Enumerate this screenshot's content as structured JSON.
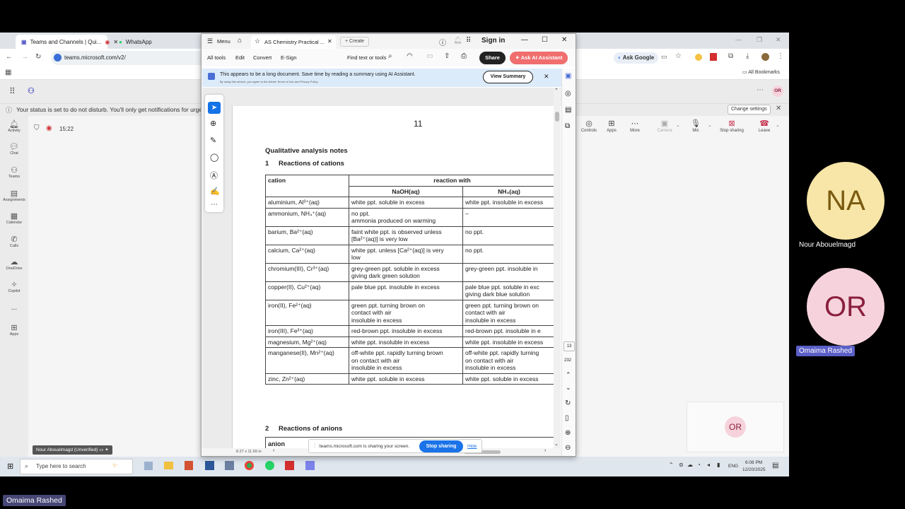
{
  "browser": {
    "tabs": [
      {
        "label": "Teams and Channels | Qui...",
        "active": true
      },
      {
        "label": "WhatsApp",
        "active": false
      }
    ],
    "url": "teams.microsoft.com/v2/",
    "ask_google": "Ask Google",
    "all_bookmarks": "All Bookmarks"
  },
  "teams": {
    "status_message": "Your status is set to do not disturb. You'll only get notifications for urgent",
    "change_settings": "Change settings",
    "call_time": "15:22",
    "avatar_initials": "OR",
    "rail": [
      {
        "label": "Activity"
      },
      {
        "label": "Chat"
      },
      {
        "label": "Teams"
      },
      {
        "label": "Assignments"
      },
      {
        "label": "Calendar"
      },
      {
        "label": "Calls"
      },
      {
        "label": "OneDrive"
      },
      {
        "label": "Copilot"
      },
      {
        "label": "..."
      },
      {
        "label": "Apps"
      }
    ],
    "call_controls": [
      {
        "label": "Controls"
      },
      {
        "label": "Apps"
      },
      {
        "label": "More"
      },
      {
        "label": "Camera"
      },
      {
        "label": "Mic"
      },
      {
        "label": "Stop sharing"
      },
      {
        "label": "Leave"
      }
    ],
    "presenter_label": "Nour Abouelmagd (Unverified)",
    "self_tile_initials": "OR"
  },
  "pdf": {
    "menu": "Menu",
    "tab_title": "AS Chemistry Practical ...",
    "create": "Create",
    "sign_in": "Sign in",
    "toolbar": [
      "All tools",
      "Edit",
      "Convert",
      "E-Sign"
    ],
    "find_text": "Find text or tools",
    "share": "Share",
    "ai_assistant": "Ask AI Assistant",
    "banner_text": "This appears to be a long document. Save time by reading a summary using AI Assistant.",
    "banner_small": "By using this service, you agree to the Adobe Terms of Use and Privacy Policy.",
    "view_summary": "View Summary",
    "page_size": "8.27 x 11.69 in",
    "current_page": "13",
    "total_pages": "232",
    "page_number_printed": "11",
    "heading": "Qualitative analysis notes",
    "section1_num": "1",
    "section1": "Reactions of cations",
    "section2_num": "2",
    "section2": "Reactions of anions",
    "anion_header": "anion",
    "table": {
      "col_cation": "cation",
      "col_reaction": "reaction with",
      "col_naoh": "NaOH(aq)",
      "col_nh3": "NH₃(aq)",
      "rows": [
        {
          "cation": "aluminium, Al³⁺(aq)",
          "naoh": [
            "white ppt. soluble in excess"
          ],
          "nh3": [
            "white ppt. insoluble in excess"
          ]
        },
        {
          "cation": "ammonium, NH₄⁺(aq)",
          "naoh": [
            "no ppt.",
            "ammonia produced on warming"
          ],
          "nh3": [
            "–"
          ]
        },
        {
          "cation": "barium, Ba²⁺(aq)",
          "naoh": [
            "faint white ppt. is observed unless",
            "[Ba²⁺(aq)] is very low"
          ],
          "nh3": [
            "no ppt."
          ]
        },
        {
          "cation": "calcium, Ca²⁺(aq)",
          "naoh": [
            "white ppt. unless [Ca²⁺(aq)] is very",
            "low"
          ],
          "nh3": [
            "no ppt."
          ]
        },
        {
          "cation": "chromium(III), Cr³⁺(aq)",
          "naoh": [
            "grey-green ppt. soluble in excess",
            "giving dark green solution"
          ],
          "nh3": [
            "grey-green ppt. insoluble in"
          ]
        },
        {
          "cation": "copper(II), Cu²⁺(aq)",
          "naoh": [
            "pale blue ppt. insoluble in excess"
          ],
          "nh3": [
            "pale blue ppt. soluble in exc",
            "giving dark blue solution"
          ]
        },
        {
          "cation": "iron(II), Fe²⁺(aq)",
          "naoh": [
            "green ppt. turning brown on",
            "contact with air",
            "insoluble in excess"
          ],
          "nh3": [
            "green ppt. turning brown on",
            "contact with air",
            "insoluble in excess"
          ]
        },
        {
          "cation": "iron(III), Fe³⁺(aq)",
          "naoh": [
            "red-brown ppt. insoluble in excess"
          ],
          "nh3": [
            "red-brown ppt. insoluble in e"
          ]
        },
        {
          "cation": "magnesium, Mg²⁺(aq)",
          "naoh": [
            "white ppt. insoluble in excess"
          ],
          "nh3": [
            "white ppt. insoluble in excess"
          ]
        },
        {
          "cation": "manganese(II), Mn²⁺(aq)",
          "naoh": [
            "off-white ppt. rapidly turning brown",
            "on contact with air",
            "insoluble in excess"
          ],
          "nh3": [
            "off-white ppt. rapidly turning",
            "on contact with air",
            "insoluble in excess"
          ]
        },
        {
          "cation": "zinc, Zn²⁺(aq)",
          "naoh": [
            "white ppt. soluble in excess"
          ],
          "nh3": [
            "white ppt. soluble in excess"
          ]
        }
      ]
    }
  },
  "sharing": {
    "message": "teams.microsoft.com is sharing your screen.",
    "stop": "Stop sharing",
    "hide": "Hide"
  },
  "taskbar": {
    "search_placeholder": "Type here to search",
    "language": "ENG",
    "time": "6:08 PM",
    "date": "12/20/2025"
  },
  "participants": [
    {
      "initials": "NA",
      "name": "Nour Abouelmagd",
      "bg": "#f7e6a8",
      "fg": "#7a5a10"
    },
    {
      "initials": "OR",
      "name": "Omaima Rashed",
      "bg": "#f6d3dc",
      "fg": "#8a1f3e"
    }
  ],
  "bottom_label": "Omaima Rashed",
  "colors": {
    "teams_purple": "#5b5fc7",
    "adobe_red": "#e34850",
    "ai_gradient": "#f06e6e",
    "leave_red": "#c4314b"
  }
}
